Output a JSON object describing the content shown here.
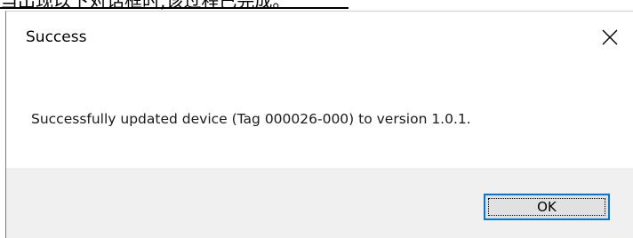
{
  "document": {
    "caption": "当出现以下对话框时,该过程已完成。"
  },
  "dialog": {
    "title": "Success",
    "message": "Successfully updated device (Tag 000026-000) to version 1.0.1.",
    "ok_label": "OK",
    "close_icon": "close-icon"
  },
  "colors": {
    "footer_background": "#f0f0f0",
    "button_border_accent": "#0078d7",
    "button_background": "#e1e1e1"
  }
}
